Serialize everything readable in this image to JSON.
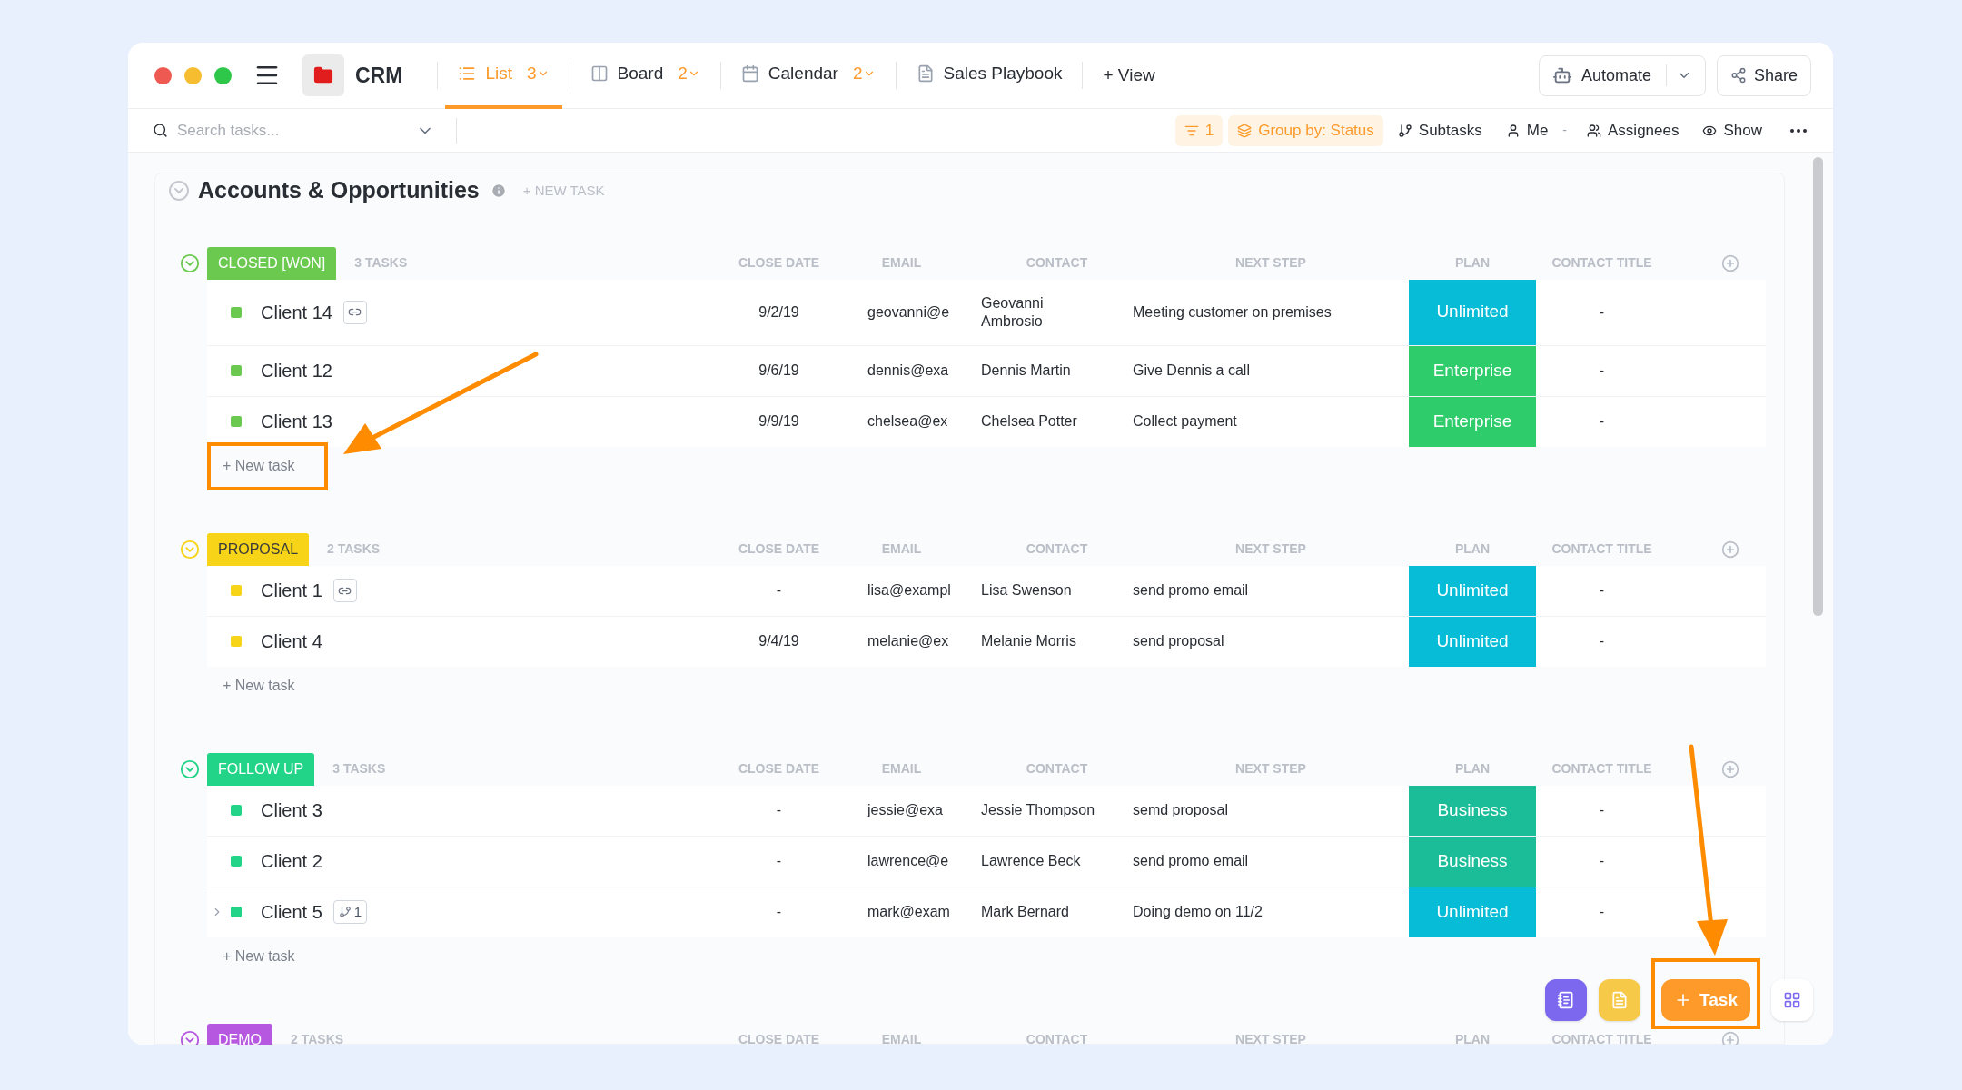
{
  "window": {
    "controls": [
      {
        "color": "#ee5a52"
      },
      {
        "color": "#f5bd2f"
      },
      {
        "color": "#2fc74a"
      }
    ],
    "title": "CRM"
  },
  "tabs": [
    {
      "kind": "list",
      "label": "List",
      "count": "3",
      "selected": true
    },
    {
      "kind": "board",
      "label": "Board",
      "count": "2",
      "selected": false
    },
    {
      "kind": "calendar",
      "label": "Calendar",
      "count": "2",
      "selected": false
    },
    {
      "kind": "doc",
      "label": "Sales Playbook",
      "selected": false
    }
  ],
  "add_view": "+ View",
  "automate_button": "Automate",
  "share_button": "Share",
  "search": {
    "placeholder": "Search tasks..."
  },
  "filters": [
    {
      "kind": "filter",
      "label": "1"
    },
    {
      "kind": "group",
      "label": "Group by: Status"
    },
    {
      "kind": "subtasks",
      "label": "Subtasks"
    },
    {
      "kind": "me",
      "label": "Me"
    },
    {
      "kind": "sep",
      "label": "-"
    },
    {
      "kind": "assignees",
      "label": "Assignees"
    },
    {
      "kind": "show",
      "label": "Show"
    }
  ],
  "list": {
    "title": "Accounts & Opportunities",
    "new_task": "+ NEW TASK"
  },
  "groups": [
    {
      "status": "CLOSED [WON]",
      "color": "#6bc950",
      "count": "3 TASKS",
      "columns": [
        "CLOSE DATE",
        "EMAIL",
        "CONTACT",
        "NEXT STEP",
        "PLAN",
        "CONTACT TITLE"
      ],
      "new_task": "+ New task",
      "highlighted": true,
      "rows": [
        {
          "name": "Client 14",
          "badge": {
            "kind": "link"
          },
          "expander": false,
          "close_date": "9/2/19",
          "email": "geovanni@e",
          "contact": "Geovanni Ambrosio",
          "next_step": "Meeting customer on premises",
          "plan": {
            "label": "Unlimited",
            "color": "#07bcd6"
          },
          "contact_title": "-"
        },
        {
          "name": "Client 12",
          "expander": false,
          "close_date": "9/6/19",
          "email": "dennis@exa",
          "contact": "Dennis Martin",
          "next_step": "Give Dennis a call",
          "plan": {
            "label": "Enterprise",
            "color": "#2fcc6b"
          },
          "contact_title": "-"
        },
        {
          "name": "Client 13",
          "expander": false,
          "close_date": "9/9/19",
          "email": "chelsea@ex",
          "contact": "Chelsea Potter",
          "next_step": "Collect payment",
          "plan": {
            "label": "Enterprise",
            "color": "#2fcc6b"
          },
          "contact_title": "-"
        }
      ]
    },
    {
      "status": "PROPOSAL",
      "color": "#f7d417",
      "count": "2 TASKS",
      "columns": [
        "CLOSE DATE",
        "EMAIL",
        "CONTACT",
        "NEXT STEP",
        "PLAN",
        "CONTACT TITLE"
      ],
      "new_task": "+ New task",
      "highlighted": false,
      "rows": [
        {
          "name": "Client 1",
          "badge": {
            "kind": "link"
          },
          "expander": false,
          "close_date": "-",
          "email": "lisa@exampl",
          "contact": "Lisa Swenson",
          "next_step": "send promo email",
          "plan": {
            "label": "Unlimited",
            "color": "#07bcd6"
          },
          "contact_title": "-"
        },
        {
          "name": "Client 4",
          "expander": false,
          "close_date": "9/4/19",
          "email": "melanie@ex",
          "contact": "Melanie Morris",
          "next_step": "send proposal",
          "plan": {
            "label": "Unlimited",
            "color": "#07bcd6"
          },
          "contact_title": "-"
        }
      ]
    },
    {
      "status": "FOLLOW UP",
      "color": "#22d487",
      "count": "3 TASKS",
      "columns": [
        "CLOSE DATE",
        "EMAIL",
        "CONTACT",
        "NEXT STEP",
        "PLAN",
        "CONTACT TITLE"
      ],
      "new_task": "+ New task",
      "highlighted": false,
      "rows": [
        {
          "name": "Client 3",
          "expander": false,
          "close_date": "-",
          "email": "jessie@exa",
          "contact": "Jessie Thompson",
          "next_step": "semd proposal",
          "plan": {
            "label": "Business",
            "color": "#1bbd98"
          },
          "contact_title": "-"
        },
        {
          "name": "Client 2",
          "expander": false,
          "close_date": "-",
          "email": "lawrence@e",
          "contact": "Lawrence Beck",
          "next_step": "send promo email",
          "plan": {
            "label": "Business",
            "color": "#1bbd98"
          },
          "contact_title": "-"
        },
        {
          "name": "Client 5",
          "badge": {
            "kind": "subtasks",
            "count": "1"
          },
          "expander": true,
          "close_date": "-",
          "email": "mark@exam",
          "contact": "Mark Bernard",
          "next_step": "Doing demo on 11/2",
          "plan": {
            "label": "Unlimited",
            "color": "#07bcd6"
          },
          "contact_title": "-"
        }
      ]
    },
    {
      "status": "DEMO",
      "color": "#b659e0",
      "count": "2 TASKS",
      "columns": [
        "CLOSE DATE",
        "EMAIL",
        "CONTACT",
        "NEXT STEP",
        "PLAN",
        "CONTACT TITLE"
      ]
    }
  ],
  "floating": [
    {
      "kind": "notepad",
      "color": "#7b68ee"
    },
    {
      "kind": "doc",
      "color": "#f7c948"
    },
    {
      "kind": "task",
      "color": "#fd9a2a",
      "label": "Task",
      "highlighted": true
    },
    {
      "kind": "apps",
      "color": "#ffffff"
    }
  ]
}
